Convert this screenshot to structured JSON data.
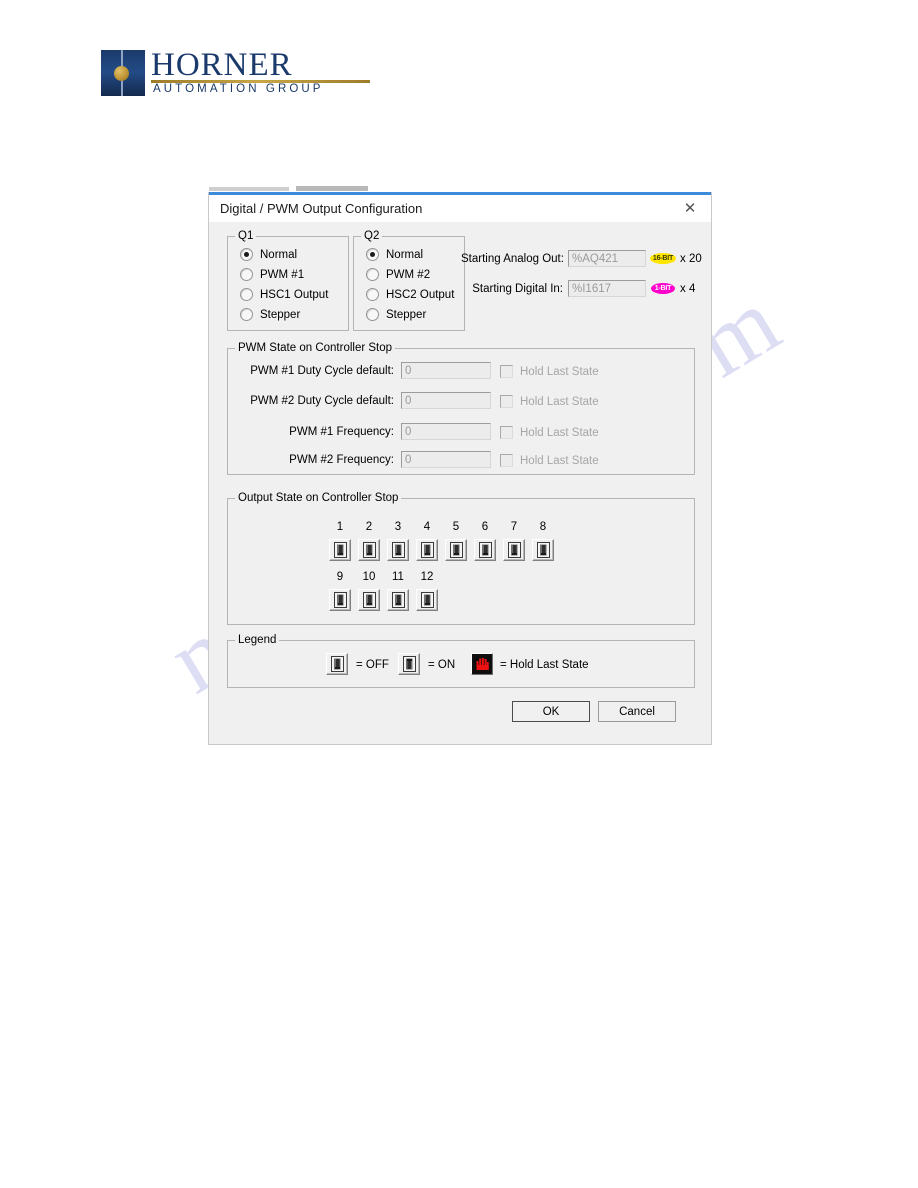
{
  "logo": {
    "word": "HORNER",
    "sub": "AUTOMATION GROUP"
  },
  "watermark": "manualshive.com",
  "dialog": {
    "title": "Digital / PWM Output Configuration",
    "close_icon": "✕",
    "q1": {
      "legend": "Q1",
      "options": [
        {
          "label": "Normal",
          "selected": true
        },
        {
          "label": "PWM #1",
          "selected": false
        },
        {
          "label": "HSC1 Output",
          "selected": false
        },
        {
          "label": "Stepper",
          "selected": false
        }
      ]
    },
    "q2": {
      "legend": "Q2",
      "options": [
        {
          "label": "Normal",
          "selected": true
        },
        {
          "label": "PWM #2",
          "selected": false
        },
        {
          "label": "HSC2 Output",
          "selected": false
        },
        {
          "label": "Stepper",
          "selected": false
        }
      ]
    },
    "registers": {
      "analog_out_label": "Starting Analog Out:",
      "analog_out_value": "%AQ421",
      "analog_out_badge": "16-BIT",
      "analog_out_badge_color": "#ffe500",
      "analog_out_mult": "x 20",
      "digital_in_label": "Starting Digital In:",
      "digital_in_value": "%I1617",
      "digital_in_badge": "1-BIT",
      "digital_in_badge_color": "#ff00cc",
      "digital_in_mult": "x 4"
    },
    "pwm_state": {
      "legend": "PWM State on Controller Stop",
      "hold_label": "Hold Last State",
      "rows": [
        {
          "label": "PWM #1 Duty Cycle default:",
          "value": "0",
          "hold_checked": false
        },
        {
          "label": "PWM #2 Duty Cycle default:",
          "value": "0",
          "hold_checked": false
        },
        {
          "label": "PWM #1 Frequency:",
          "value": "0",
          "hold_checked": false
        },
        {
          "label": "PWM #2 Frequency:",
          "value": "0",
          "hold_checked": false
        }
      ]
    },
    "output_state": {
      "legend": "Output State on Controller Stop",
      "row1": [
        "1",
        "2",
        "3",
        "4",
        "5",
        "6",
        "7",
        "8"
      ],
      "row2": [
        "9",
        "10",
        "11",
        "12"
      ],
      "all_state": "OFF"
    },
    "legend_box": {
      "legend": "Legend",
      "off_text": "= OFF",
      "on_text": "= ON",
      "hold_text": "= Hold Last State",
      "hold_color": "#ee1111"
    },
    "buttons": {
      "ok": "OK",
      "cancel": "Cancel"
    }
  }
}
